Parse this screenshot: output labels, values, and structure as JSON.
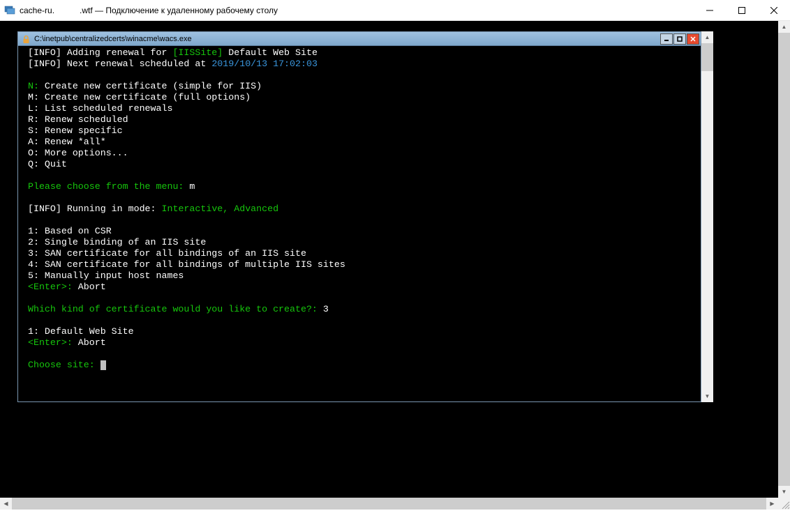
{
  "rdp": {
    "title_prefix": "cache-ru.",
    "title_suffix": ".wtf — Подключение к удаленному рабочему столу"
  },
  "console": {
    "title": "C:\\inetpub\\centralizedcerts\\winacme\\wacs.exe",
    "lines": {
      "info1_tag": " [INFO] ",
      "info1_text": "Adding renewal for ",
      "info1_bracket": "[IISSite]",
      "info1_site": " Default Web Site",
      "info2_tag": " [INFO] ",
      "info2_text": "Next renewal scheduled at ",
      "info2_date": "2019/10/13 17:02:03",
      "menu_n_key": " N: ",
      "menu_n": "Create new certificate (simple for IIS)",
      "menu_m_key": " M: ",
      "menu_m": "Create new certificate (full options)",
      "menu_l_key": " L: ",
      "menu_l": "List scheduled renewals",
      "menu_r_key": " R: ",
      "menu_r": "Renew scheduled",
      "menu_s_key": " S: ",
      "menu_s": "Renew specific",
      "menu_a_key": " A: ",
      "menu_a": "Renew *all*",
      "menu_o_key": " O: ",
      "menu_o": "More options...",
      "menu_q_key": " Q: ",
      "menu_q": "Quit",
      "prompt1": " Please choose from the menu: ",
      "prompt1_ans": "m",
      "info3_tag": " [INFO] ",
      "info3_text": "Running in mode: ",
      "info3_mode": "Interactive, Advanced",
      "opt1_key": " 1: ",
      "opt1": "Based on CSR",
      "opt2_key": " 2: ",
      "opt2": "Single binding of an IIS site",
      "opt3_key": " 3: ",
      "opt3": "SAN certificate for all bindings of an IIS site",
      "opt4_key": " 4: ",
      "opt4": "SAN certificate for all bindings of multiple IIS sites",
      "opt5_key": " 5: ",
      "opt5": "Manually input host names",
      "enter1_key": " <Enter>: ",
      "enter1": "Abort",
      "prompt2": " Which kind of certificate would you like to create?: ",
      "prompt2_ans": "3",
      "site1_key": " 1: ",
      "site1": "Default Web Site",
      "enter2_key": " <Enter>: ",
      "enter2": "Abort",
      "prompt3": " Choose site: "
    }
  }
}
